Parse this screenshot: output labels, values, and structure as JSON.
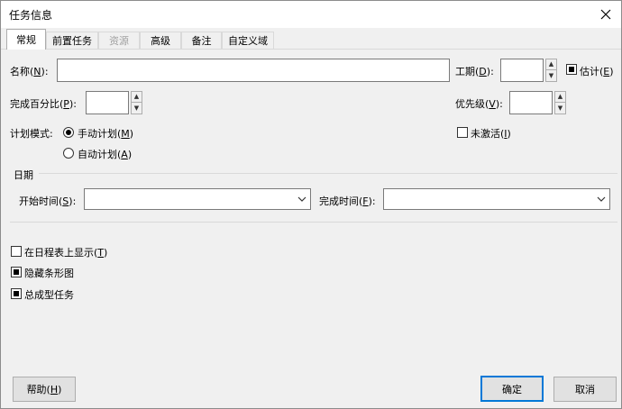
{
  "window": {
    "title": "任务信息"
  },
  "tabs": [
    {
      "label": "常规"
    },
    {
      "label": "前置任务"
    },
    {
      "label": "资源"
    },
    {
      "label": "高级"
    },
    {
      "label": "备注"
    },
    {
      "label": "自定义域"
    }
  ],
  "general": {
    "name_label": "名称(",
    "name_key": "N",
    "duration_label": "工期(",
    "duration_key": "D",
    "estimated_label": "估计(",
    "estimated_key": "E",
    "percent_label": "完成百分比(",
    "percent_key": "P",
    "priority_label": "优先级(",
    "priority_key": "V",
    "schedule_mode_label": "计划模式:",
    "manual_label": "手动计划(",
    "manual_key": "M",
    "auto_label": "自动计划(",
    "auto_key": "A",
    "inactive_label": "未激活(",
    "inactive_key": "I",
    "close_paren_colon": "):",
    "close_paren": ")"
  },
  "dates": {
    "section_label": "日期",
    "start_label": "开始时间(",
    "start_key": "S",
    "finish_label": "完成时间(",
    "finish_key": "F"
  },
  "options": {
    "timeline_label": "在日程表上显示(",
    "timeline_key": "T",
    "hide_bar_label": "隐藏条形图",
    "summary_label": "总成型任务"
  },
  "buttons": {
    "help_label": "帮助(",
    "help_key": "H",
    "ok_label": "确定",
    "cancel_label": "取消"
  },
  "state": {
    "estimated": true,
    "manual_schedule": true,
    "inactive": false,
    "show_on_timeline": false,
    "hide_bar": true,
    "summary": true
  },
  "colors": {
    "accent": "#0078d7",
    "disabled_text": "#a0a0a0"
  },
  "icons": {
    "close": "close-icon",
    "dropdown": "chevron-down-icon",
    "spin_up": "arrow-up-icon",
    "spin_down": "arrow-down-icon"
  }
}
